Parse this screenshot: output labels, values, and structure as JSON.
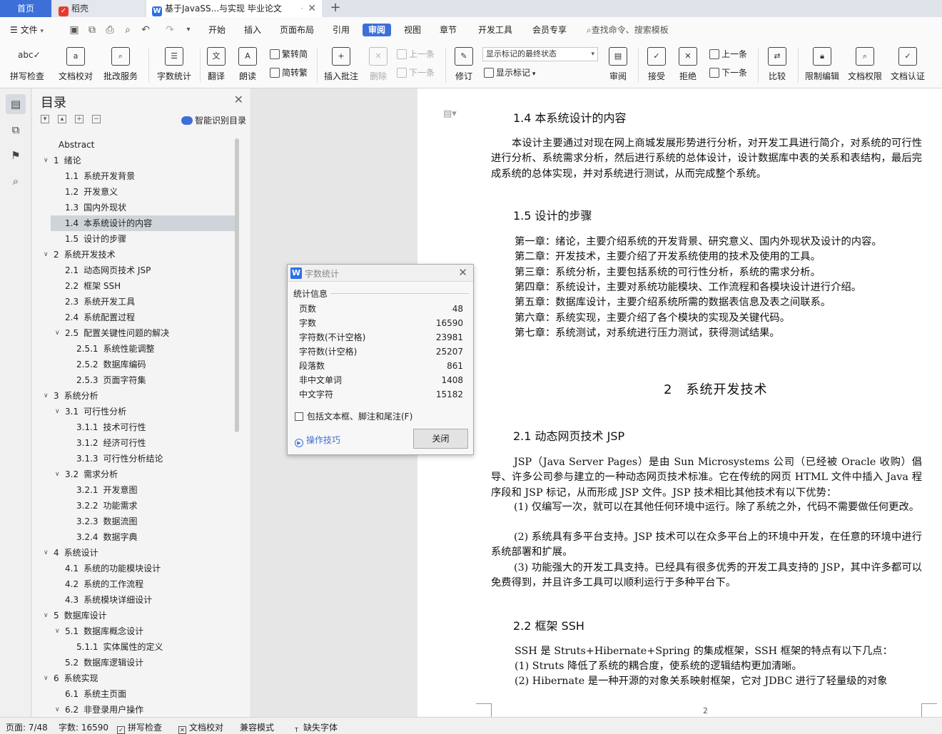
{
  "tabs": {
    "home": "首页",
    "daoke": "稻壳",
    "doc": "基于JavaSS...与实现 毕业论文",
    "new_tab": "+"
  },
  "menu": {
    "file": "文件",
    "items": [
      "开始",
      "插入",
      "页面布局",
      "引用",
      "审阅",
      "视图",
      "章节",
      "开发工具",
      "会员专享"
    ],
    "active": "审阅",
    "search": "查找命令、搜索模板"
  },
  "ribbon": {
    "spellcheck": "拼写检查",
    "proofread": "文档校对",
    "batch": "批改服务",
    "wordcount": "字数统计",
    "translate": "翻译",
    "readaloud": "朗读",
    "to_traditional": "繁转简",
    "to_simplified": "简转繁",
    "insert_comment": "插入批注",
    "delete": "删除",
    "prev_comment": "上一条",
    "next_comment": "下一条",
    "revise": "修订",
    "markup_state": "显示标记的最终状态",
    "show_markup": "显示标记",
    "review": "审阅",
    "accept": "接受",
    "reject": "拒绝",
    "prev_change": "上一条",
    "next_change": "下一条",
    "compare": "比较",
    "restrict": "限制编辑",
    "permission": "文档权限",
    "certify": "文档认证"
  },
  "toc": {
    "title": "目录",
    "smart": "智能识别目录",
    "items": [
      {
        "level": 1,
        "num": "",
        "text": "Abstract",
        "caret": false
      },
      {
        "level": 1,
        "num": "1",
        "text": "绪论",
        "caret": true
      },
      {
        "level": 2,
        "num": "1.1",
        "text": "系统开发背景",
        "caret": false
      },
      {
        "level": 2,
        "num": "1.2",
        "text": "开发意义",
        "caret": false
      },
      {
        "level": 2,
        "num": "1.3",
        "text": "国内外现状",
        "caret": false
      },
      {
        "level": 2,
        "num": "1.4",
        "text": "本系统设计的内容",
        "caret": false,
        "selected": true
      },
      {
        "level": 2,
        "num": "1.5",
        "text": "设计的步骤",
        "caret": false
      },
      {
        "level": 1,
        "num": "2",
        "text": "系统开发技术",
        "caret": true
      },
      {
        "level": 2,
        "num": "2.1",
        "text": "动态网页技术 JSP",
        "caret": false
      },
      {
        "level": 2,
        "num": "2.2",
        "text": "框架 SSH",
        "caret": false
      },
      {
        "level": 2,
        "num": "2.3",
        "text": "系统开发工具",
        "caret": false
      },
      {
        "level": 2,
        "num": "2.4",
        "text": "系统配置过程",
        "caret": false
      },
      {
        "level": 2,
        "num": "2.5",
        "text": "配置关键性问题的解决",
        "caret": true
      },
      {
        "level": 3,
        "num": "2.5.1",
        "text": "系统性能调整",
        "caret": false
      },
      {
        "level": 3,
        "num": "2.5.2",
        "text": "数据库编码",
        "caret": false
      },
      {
        "level": 3,
        "num": "2.5.3",
        "text": "页面字符集",
        "caret": false
      },
      {
        "level": 1,
        "num": "3",
        "text": "系统分析",
        "caret": true
      },
      {
        "level": 2,
        "num": "3.1",
        "text": "可行性分析",
        "caret": true
      },
      {
        "level": 3,
        "num": "3.1.1",
        "text": "技术可行性",
        "caret": false
      },
      {
        "level": 3,
        "num": "3.1.2",
        "text": "经济可行性",
        "caret": false
      },
      {
        "level": 3,
        "num": "3.1.3",
        "text": "可行性分析结论",
        "caret": false
      },
      {
        "level": 2,
        "num": "3.2",
        "text": "需求分析",
        "caret": true
      },
      {
        "level": 3,
        "num": "3.2.1",
        "text": "开发意图",
        "caret": false
      },
      {
        "level": 3,
        "num": "3.2.2",
        "text": "功能需求",
        "caret": false
      },
      {
        "level": 3,
        "num": "3.2.3",
        "text": "数据流图",
        "caret": false
      },
      {
        "level": 3,
        "num": "3.2.4",
        "text": "数据字典",
        "caret": false
      },
      {
        "level": 1,
        "num": "4",
        "text": "系统设计",
        "caret": true
      },
      {
        "level": 2,
        "num": "4.1",
        "text": "系统的功能模块设计",
        "caret": false
      },
      {
        "level": 2,
        "num": "4.2",
        "text": "系统的工作流程",
        "caret": false
      },
      {
        "level": 2,
        "num": "4.3",
        "text": "系统模块详细设计",
        "caret": false
      },
      {
        "level": 1,
        "num": "5",
        "text": "数据库设计",
        "caret": true
      },
      {
        "level": 2,
        "num": "5.1",
        "text": "数据库概念设计",
        "caret": true
      },
      {
        "level": 3,
        "num": "5.1.1",
        "text": "实体属性的定义",
        "caret": false
      },
      {
        "level": 2,
        "num": "5.2",
        "text": "数据库逻辑设计",
        "caret": false
      },
      {
        "level": 1,
        "num": "6",
        "text": "系统实现",
        "caret": true
      },
      {
        "level": 2,
        "num": "6.1",
        "text": "系统主页面",
        "caret": false
      },
      {
        "level": 2,
        "num": "6.2",
        "text": "非登录用户操作",
        "caret": true
      }
    ]
  },
  "doc": {
    "h14": "1.4 本系统设计的内容",
    "p14": "本设计主要通过对现在网上商城发展形势进行分析，对开发工具进行简介，对系统的可行性进行分析、系统需求分析，然后进行系统的总体设计，设计数据库中表的关系和表结构，最后完成系统的总体实现，并对系统进行测试，从而完成整个系统。",
    "h15": "1.5 设计的步骤",
    "steps": [
      "第一章：绪论，主要介绍系统的开发背景、研究意义、国内外现状及设计的内容。",
      "第二章：开发技术，主要介绍了开发系统使用的技术及使用的工具。",
      "第三章：系统分析，主要包括系统的可行性分析，系统的需求分析。",
      "第四章：系统设计，主要对系统功能模块、工作流程和各模块设计进行介绍。",
      "第五章：数据库设计，主要介绍系统所需的数据表信息及表之间联系。",
      "第六章：系统实现，主要介绍了各个模块的实现及关键代码。",
      "第七章：系统测试，对系统进行压力测试，获得测试结果。"
    ],
    "h2": "2　系统开发技术",
    "h21": "2.1 动态网页技术 JSP",
    "p21": "JSP（Java Server Pages）是由 Sun Microsystems 公司（已经被 Oracle 收购）倡导、许多公司参与建立的一种动态网页技术标准。它在传统的网页 HTML 文件中插入 Java 程序段和 JSP 标记，从而形成 JSP 文件。JSP 技术相比其他技术有以下优势：",
    "p21a": "(1) 仅编写一次，就可以在其他任何环境中运行。除了系统之外，代码不需要做任何更改。",
    "p21b": "(2) 系统具有多平台支持。JSP 技术可以在众多平台上的环境中开发，在任意的环境中进行系统部署和扩展。",
    "p21c": "(3) 功能强大的开发工具支持。已经具有很多优秀的开发工具支持的 JSP，其中许多都可以免费得到，并且许多工具可以顺利运行于多种平台下。",
    "h22": "2.2 框架 SSH",
    "p22": "SSH 是 Struts+Hibernate+Spring 的集成框架，SSH 框架的特点有以下几点：",
    "p22a": "(1) Struts 降低了系统的耦合度，使系统的逻辑结构更加清晰。",
    "p22b": "(2) Hibernate 是一种开源的对象关系映射框架，它对 JDBC 进行了轻量级的对象",
    "page_num": "2"
  },
  "wordcount": {
    "title": "字数统计",
    "section": "统计信息",
    "rows": [
      {
        "label": "页数",
        "value": "48"
      },
      {
        "label": "字数",
        "value": "16590"
      },
      {
        "label": "字符数(不计空格)",
        "value": "23981"
      },
      {
        "label": "字符数(计空格)",
        "value": "25207"
      },
      {
        "label": "段落数",
        "value": "861"
      },
      {
        "label": "非中文单词",
        "value": "1408"
      },
      {
        "label": "中文字符",
        "value": "15182"
      }
    ],
    "include": "包括文本框、脚注和尾注(F)",
    "tips": "操作技巧",
    "close": "关闭"
  },
  "status": {
    "page": "页面: 7/48",
    "words": "字数: 16590",
    "spell": "拼写检查",
    "proof": "文档校对",
    "compat": "兼容模式",
    "missing_font": "缺失字体"
  }
}
